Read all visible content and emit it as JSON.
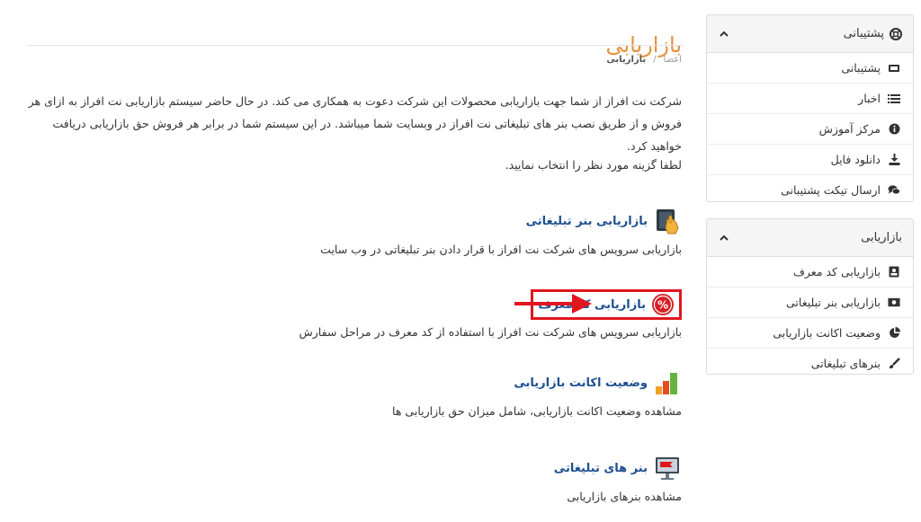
{
  "page": {
    "title": "بازاریابی",
    "breadcrumb": [
      "اعضا",
      "/",
      "بازاریابی"
    ],
    "intro": "شرکت نت افراز از شما جهت بازاریابی محصولات این شرکت دعوت به همکاری می کند. در حال حاضر سیستم بازاریابی نت افراز به ازای هر فروش و از طریق نصب بنر های تبلیغاتی نت افراز در وبسایت شما میباشد. در این سیستم شما در برابر هر فروش حق بازاریابی دریافت خواهید کرد.",
    "instruction": "لطفا گزینه مورد نظر را انتخاب نمایید."
  },
  "options": [
    {
      "title": "بازاریابی بنر تبلیغاتی",
      "desc": "بازاریابی سرویس های شرکت نت افراز با قرار دادن بنر تبلیغاتی در وب سایت",
      "icon": "banner-hand-icon"
    },
    {
      "title": "بازاریابی کد معرف",
      "desc": "بازاریابی سرویس های شرکت نت افراز با استفاده از کد معرف در مراحل سفارش",
      "icon": "percent-badge-icon"
    },
    {
      "title": "وضعیت اکانت بازاریابی",
      "desc": "مشاهده وضعیت اکانت بازاریابی، شامل میزان حق بازاریابی ها",
      "icon": "bar-chart-icon"
    },
    {
      "title": "بنر های تبلیغاتی",
      "desc": "مشاهده بنرهای بازاریابی",
      "icon": "monitor-banner-icon"
    }
  ],
  "sidebar": {
    "support": {
      "title": "پشتیبانی",
      "items": [
        {
          "label": "پشتیبانی",
          "icon": "ticket-icon"
        },
        {
          "label": "اخبار",
          "icon": "list-icon"
        },
        {
          "label": "مرکز آموزش",
          "icon": "info-icon"
        },
        {
          "label": "دانلود فایل",
          "icon": "download-icon"
        },
        {
          "label": "ارسال تیکت پشتیبانی",
          "icon": "comments-icon"
        }
      ]
    },
    "marketing": {
      "title": "بازاریابی",
      "items": [
        {
          "label": "بازاریابی کد معرف",
          "icon": "id-card-icon"
        },
        {
          "label": "بازاریابی بنر تبلیغاتی",
          "icon": "money-icon"
        },
        {
          "label": "وضعیت اکانت بازاریابی",
          "icon": "pie-chart-icon"
        },
        {
          "label": "بنرهای تبلیغاتی",
          "icon": "brush-icon"
        }
      ]
    }
  },
  "colors": {
    "title": "#e8913c",
    "link": "#1d4f91",
    "highlight": "#e0161f"
  }
}
